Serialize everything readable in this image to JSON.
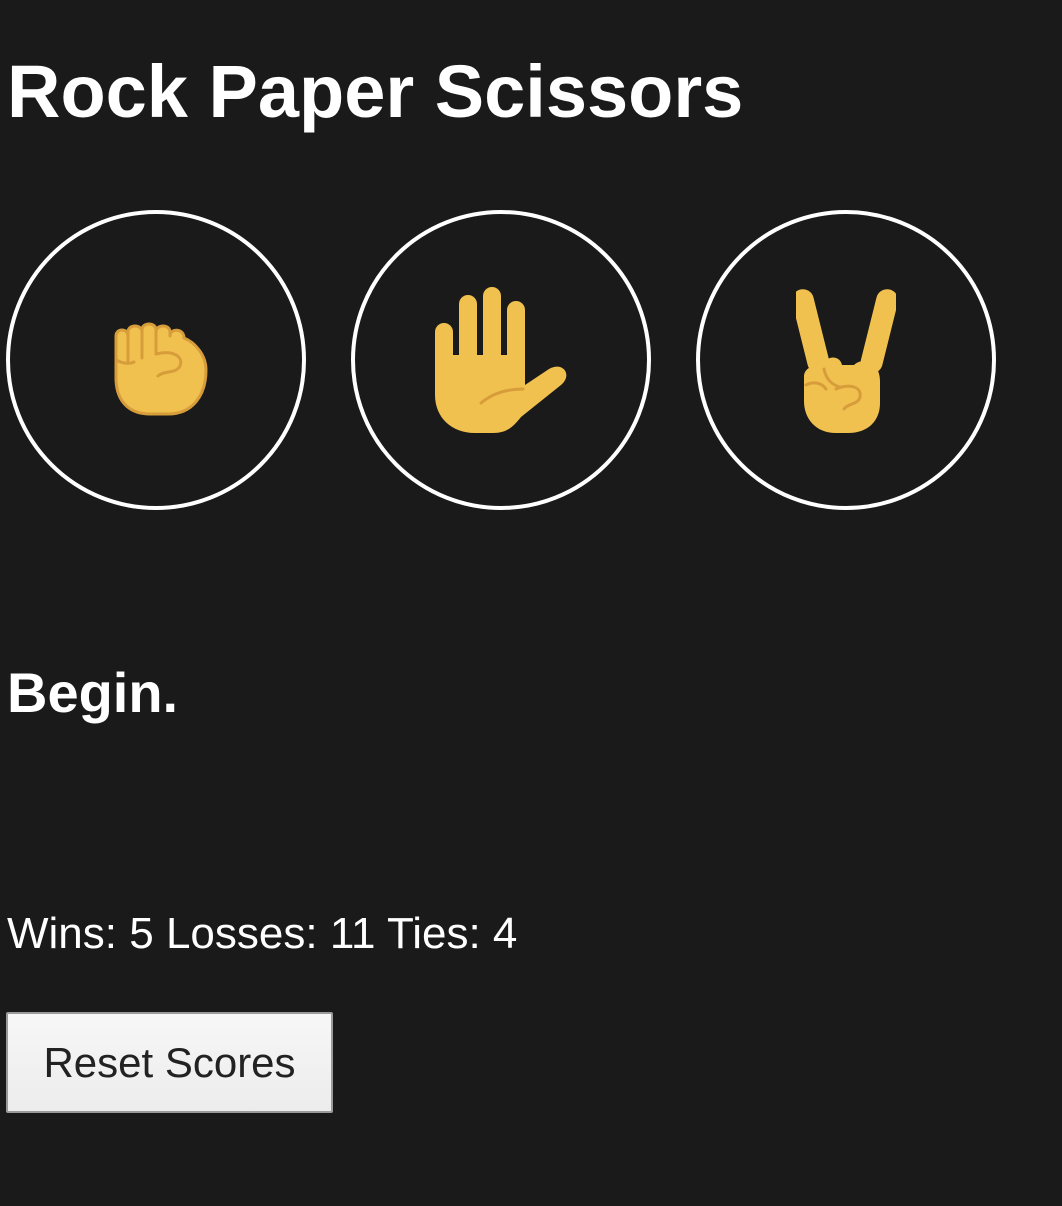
{
  "title": "Rock Paper Scissors",
  "choices": [
    {
      "label": "rock",
      "icon": "raised-fist-icon"
    },
    {
      "label": "paper",
      "icon": "raised-hand-icon"
    },
    {
      "label": "scissors",
      "icon": "victory-hand-icon"
    }
  ],
  "result_text": "Begin.",
  "scores": {
    "wins_label": "Wins:",
    "wins": "5",
    "losses_label": "Losses:",
    "losses": "11",
    "ties_label": "Ties:",
    "ties": "4"
  },
  "reset_label": "Reset Scores",
  "colors": {
    "background": "#1a1a1a",
    "text": "#ffffff",
    "skin": "#f1c150",
    "skin_line": "#d79d3a"
  }
}
